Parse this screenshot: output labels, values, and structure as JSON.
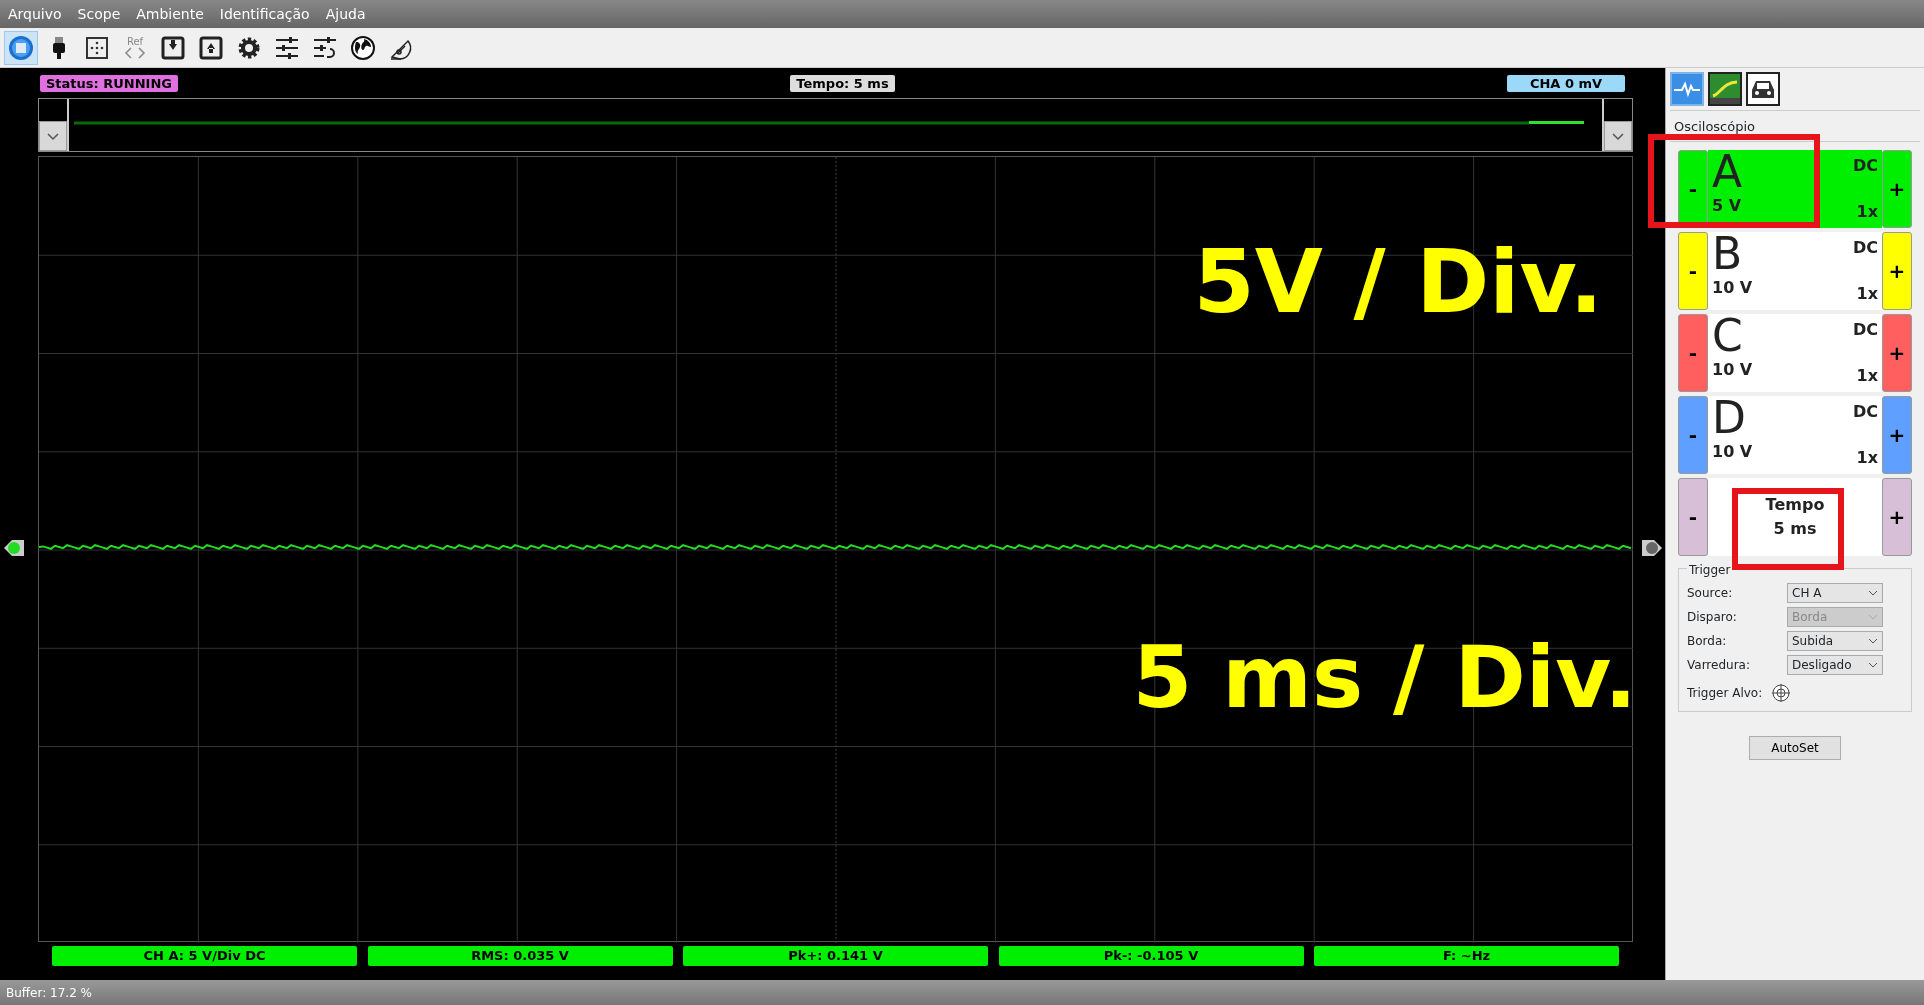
{
  "menu": [
    "Arquivo",
    "Scope",
    "Ambiente",
    "Identificação",
    "Ajuda"
  ],
  "toolbar": [
    {
      "kind": "scope",
      "selected": true
    },
    {
      "kind": "plug",
      "selected": false
    },
    {
      "kind": "grid",
      "selected": false
    },
    {
      "kind": "ref",
      "label": "Ref",
      "selected": false
    },
    {
      "kind": "download",
      "selected": false
    },
    {
      "kind": "upload",
      "selected": false
    },
    {
      "kind": "gear",
      "selected": false
    },
    {
      "kind": "sliders",
      "selected": false
    },
    {
      "kind": "sliders-undo",
      "selected": false
    },
    {
      "kind": "globe",
      "selected": false
    },
    {
      "kind": "protractor",
      "selected": false
    }
  ],
  "scope": {
    "status": "Status: RUNNING",
    "time": "Tempo: 5 ms",
    "offset": "CHA 0 mV",
    "annotations": [
      "5V / Div.",
      "5 ms / Div."
    ],
    "measurements": [
      "CH A: 5 V/Div DC",
      "RMS: 0.035 V",
      "Pk+: 0.141 V",
      "Pk-: -0.105 V",
      "F: ~Hz"
    ]
  },
  "panel": {
    "tabs": [
      {
        "kind": "scope",
        "selected": true
      },
      {
        "kind": "meter",
        "selected": false
      },
      {
        "kind": "car",
        "selected": false
      }
    ],
    "title": "Osciloscópio",
    "channels": [
      {
        "name": "A",
        "volts": "5 V",
        "coupling": "DC",
        "probe": "1x",
        "color": "#00ee00",
        "selected": true,
        "minus": "-",
        "plus": "+"
      },
      {
        "name": "B",
        "volts": "10 V",
        "coupling": "DC",
        "probe": "1x",
        "color": "#ffff00",
        "selected": false,
        "minus": "-",
        "plus": "+"
      },
      {
        "name": "C",
        "volts": "10 V",
        "coupling": "DC",
        "probe": "1x",
        "color": "#ff5f5f",
        "selected": false,
        "minus": "-",
        "plus": "+"
      },
      {
        "name": "D",
        "volts": "10 V",
        "coupling": "DC",
        "probe": "1x",
        "color": "#5f9fff",
        "selected": false,
        "minus": "-",
        "plus": "+"
      }
    ],
    "timebase": {
      "label": "Tempo",
      "value": "5 ms",
      "color": "#d8bfd8",
      "minus": "-",
      "plus": "+"
    },
    "trigger": {
      "title": "Trigger",
      "fields": [
        {
          "label": "Source:",
          "value": "CH A",
          "disabled": false
        },
        {
          "label": "Disparo:",
          "value": "Borda",
          "disabled": true
        },
        {
          "label": "Borda:",
          "value": "Subida",
          "disabled": false
        },
        {
          "label": "Varredura:",
          "value": "Desligado",
          "disabled": false
        }
      ],
      "target_label": "Trigger Alvo:"
    },
    "autoset": "AutoSet"
  },
  "status_bar": "Buffer: 17.2 %"
}
